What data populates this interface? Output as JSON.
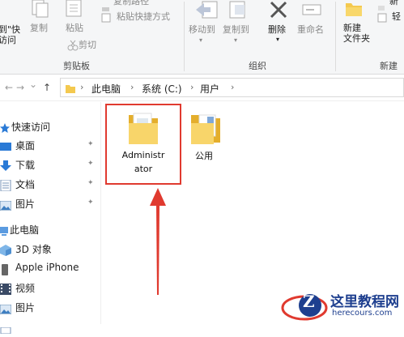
{
  "ribbon": {
    "clipboard": {
      "cut_label": "剪切",
      "cut_suffix": "到\"快",
      "cut_suffix2": "访问",
      "copy_label": "复制",
      "paste_label": "粘贴",
      "copy_path_label": "复制路径",
      "paste_shortcut_label": "粘贴快捷方式",
      "cut_small_label": "剪切",
      "group_label": "剪贴板"
    },
    "organize": {
      "move_to_label": "移动到",
      "copy_to_label": "复制到",
      "delete_label": "删除",
      "rename_label": "重命名",
      "group_label": "组织"
    },
    "new": {
      "new_folder_label_line1": "新建",
      "new_folder_label_line2": "文件夹",
      "new_item_label": "新",
      "easy_access_label": "轻",
      "group_label": "新建"
    }
  },
  "address": {
    "crumbs": [
      "此电脑",
      "系统 (C:)",
      "用户"
    ],
    "back_glyph": "←",
    "forward_glyph": "→",
    "dropdown_glyph": "⌄",
    "up_glyph": "↑",
    "sep_glyph": "›"
  },
  "nav_pane": {
    "quick_access_label": "快速访问",
    "pinned": [
      "桌面",
      "下载",
      "文档",
      "图片"
    ],
    "this_pc_label": "此电脑",
    "pc_items": [
      "3D 对象",
      "Apple iPhone",
      "视频",
      "图片"
    ],
    "pin_glyph": "✦"
  },
  "content": {
    "items": [
      {
        "line1": "Administr",
        "line2": "ator",
        "selected": true
      },
      {
        "line1": "公用",
        "line2": "",
        "selected": false
      }
    ]
  },
  "annotation": {
    "color": "#e03a2f"
  },
  "watermark": {
    "title": "这里教程网",
    "url": "herecours.com",
    "logo_letter": "Z"
  },
  "colors": {
    "folder": "#f4c94f",
    "folder_dark": "#e4ae2c",
    "accent": "#1e3f8f",
    "annotation_red": "#e03a2f"
  }
}
